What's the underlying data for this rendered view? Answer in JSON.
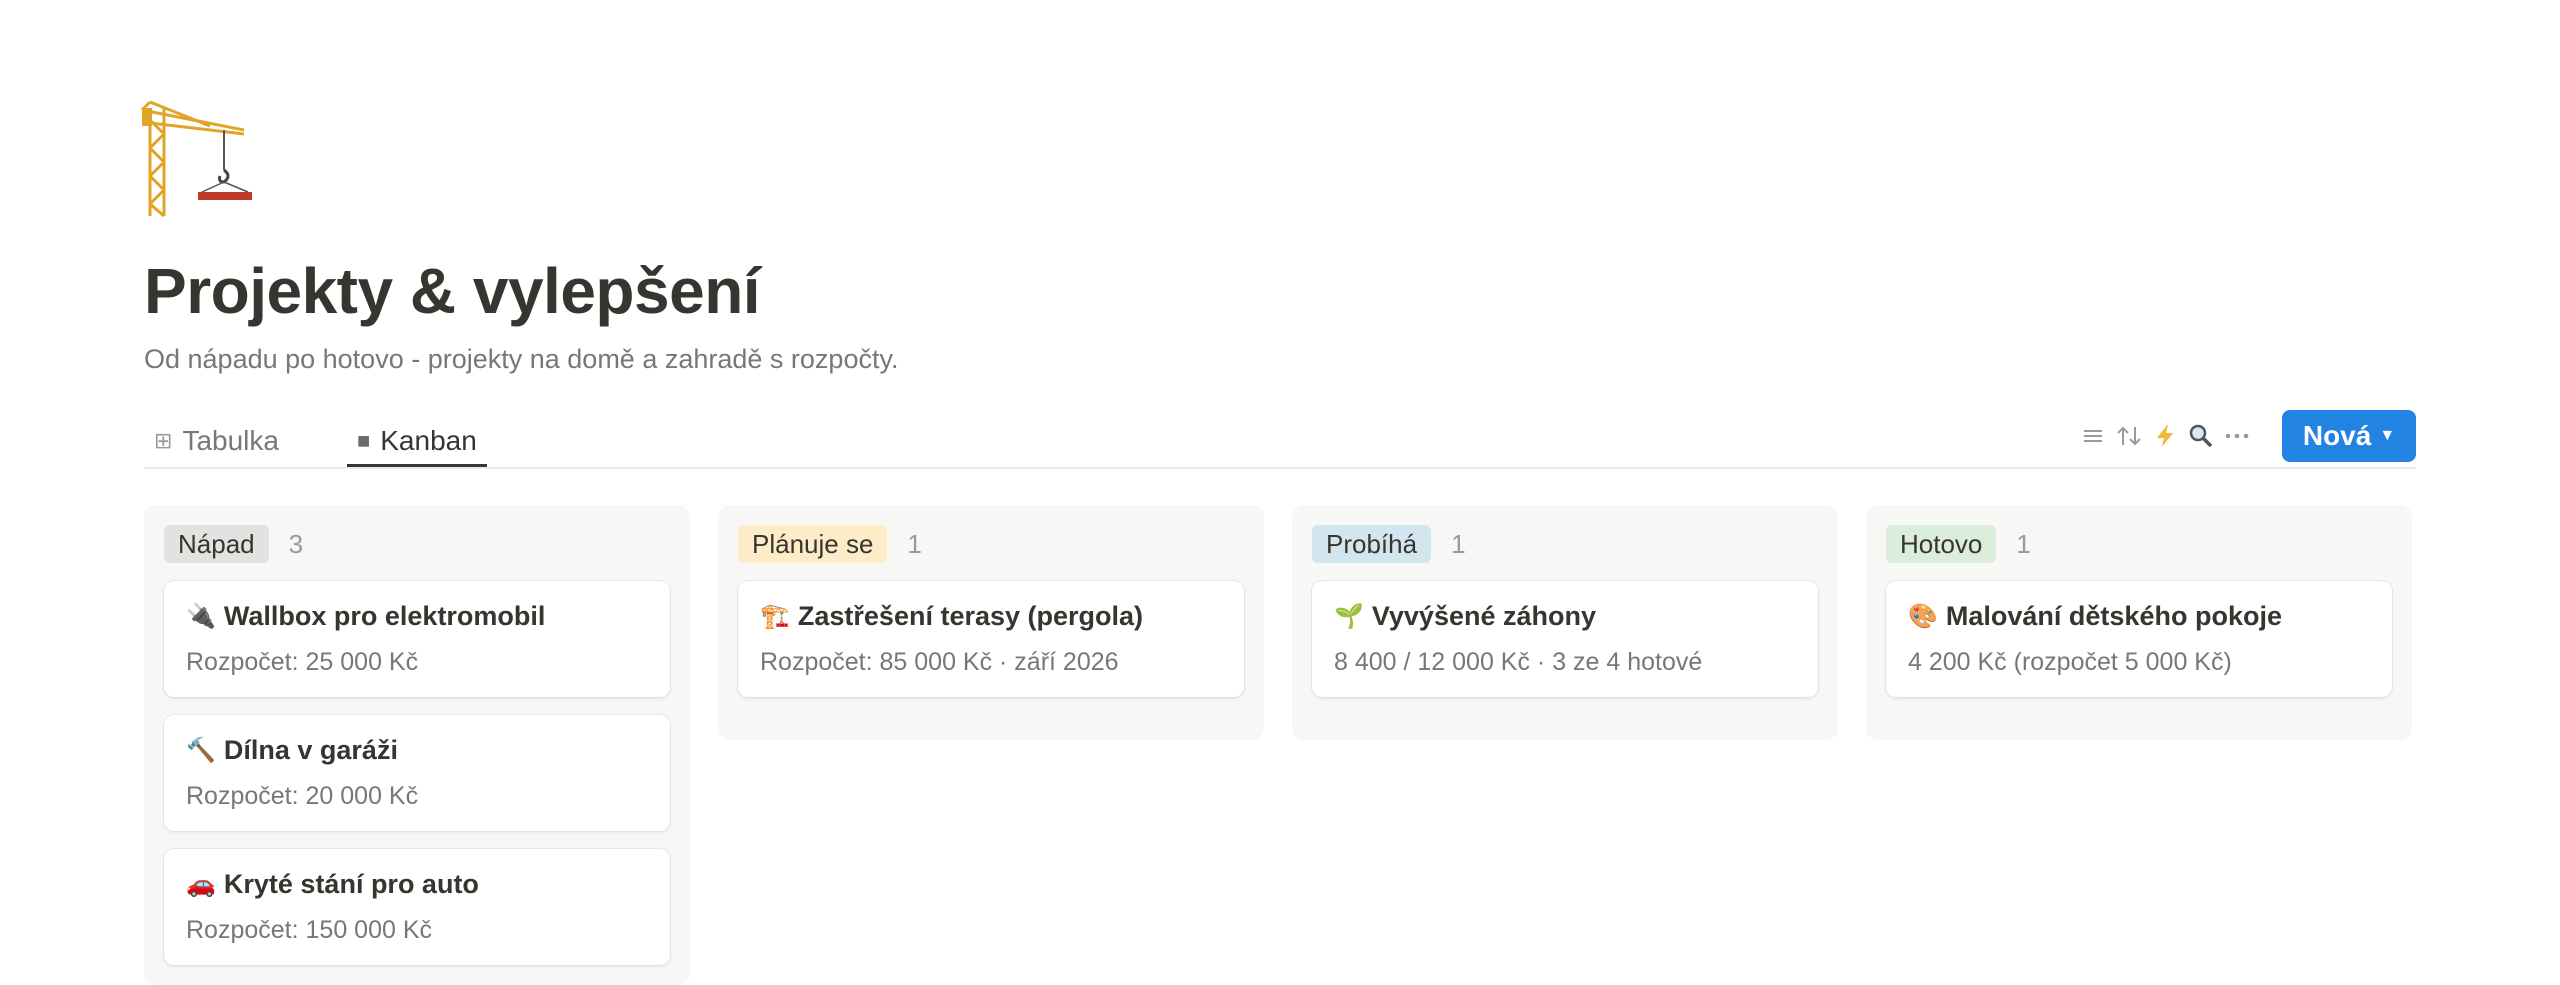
{
  "page": {
    "icon": "crane-icon",
    "title": "Projekty & vylepšení",
    "subtitle": "Od nápadu po hotovo - projekty na domě a zahradě s rozpočty."
  },
  "tabs": [
    {
      "label": "Tabulka",
      "icon": "table-icon",
      "active": false
    },
    {
      "label": "Kanban",
      "icon": "board-icon",
      "active": true
    }
  ],
  "toolbar": {
    "icons": [
      "filter-icon",
      "sort-icon",
      "automation-icon",
      "search-icon",
      "more-icon"
    ],
    "new_label": "Nová"
  },
  "columns": [
    {
      "name": "Nápad",
      "count": "3",
      "color": "#e3e2e0",
      "cards": [
        {
          "emoji": "🔌",
          "title": "Wallbox pro elektromobil",
          "meta": "Rozpočet: 25 000 Kč"
        },
        {
          "emoji": "🔨",
          "title": "Dílna v garáži",
          "meta": "Rozpočet: 20 000 Kč"
        },
        {
          "emoji": "🚗",
          "title": "Kryté stání pro auto",
          "meta": "Rozpočet: 150 000 Kč"
        }
      ]
    },
    {
      "name": "Plánuje se",
      "count": "1",
      "color": "#fdecc8",
      "cards": [
        {
          "emoji": "🏗️",
          "title": "Zastřešení terasy (pergola)",
          "meta": "Rozpočet: 85 000 Kč · září 2026"
        }
      ]
    },
    {
      "name": "Probíhá",
      "count": "1",
      "color": "#d3e5ef",
      "cards": [
        {
          "emoji": "🌱",
          "title": "Vyvýšené záhony",
          "meta": "8 400 / 12 000 Kč · 3 ze 4 hotové"
        }
      ]
    },
    {
      "name": "Hotovo",
      "count": "1",
      "color": "#dbeddb",
      "cards": [
        {
          "emoji": "🎨",
          "title": "Malování dětského pokoje",
          "meta": "4 200 Kč (rozpočet 5 000 Kč)"
        }
      ]
    }
  ]
}
